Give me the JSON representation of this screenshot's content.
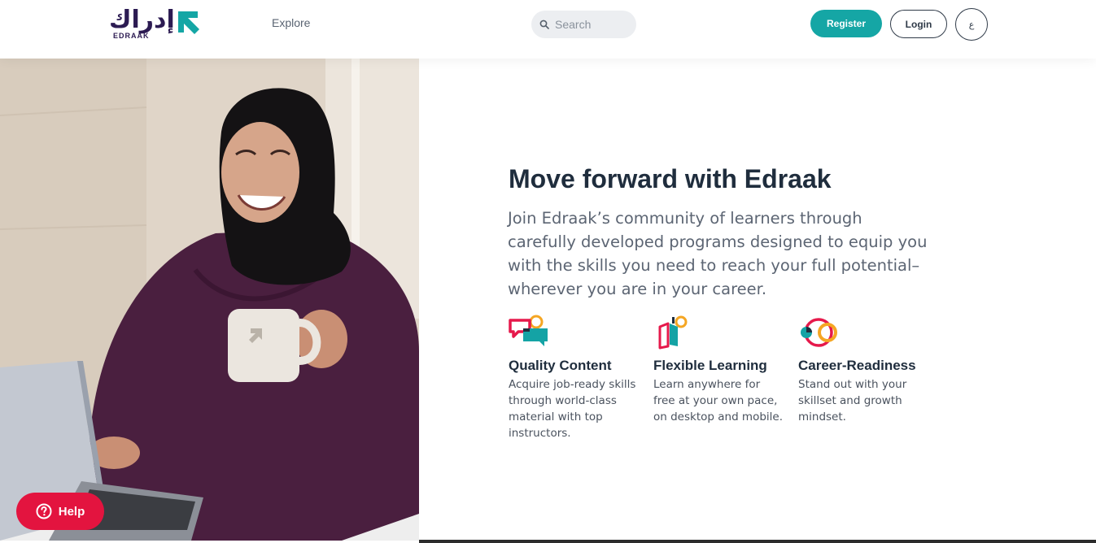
{
  "header": {
    "logo": {
      "arabic": "إدراك",
      "latin": "EDRAAK"
    },
    "nav": {
      "explore_label": "Explore"
    },
    "search": {
      "placeholder": "Search"
    },
    "register_label": "Register",
    "login_label": "Login",
    "language_label": "ع"
  },
  "hero": {
    "title": "Move forward with Edraak",
    "description": "Join Edraak’s community of learners through carefully developed programs designed to equip you with the skills you need to reach your full potential–wherever you are in your career.",
    "features": [
      {
        "icon": "chat-bubbles-icon",
        "title": "Quality Content",
        "text": "Acquire job-ready skills through world-class material with top instructors."
      },
      {
        "icon": "open-book-icon",
        "title": "Flexible Learning",
        "text": "Learn anywhere for free at your own pace, on desktop and mobile."
      },
      {
        "icon": "linked-rings-icon",
        "title": "Career-Readiness",
        "text": "Stand out with your skillset and growth mindset."
      }
    ]
  },
  "help": {
    "label": "Help",
    "icon": "question-circle-icon"
  },
  "colors": {
    "brand_teal": "#15a6a5",
    "brand_purple": "#2c1b52",
    "help_red": "#e3143f",
    "accent_orange": "#f5a623",
    "accent_pink": "#e6194b"
  }
}
